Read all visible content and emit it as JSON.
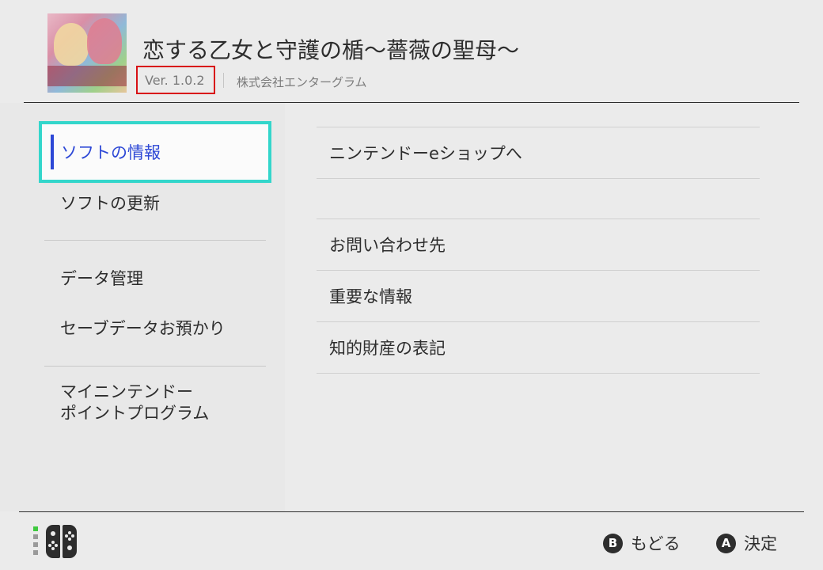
{
  "header": {
    "title": "恋する乙女と守護の楯～薔薇の聖母～",
    "version": "Ver. 1.0.2",
    "publisher": "株式会社エンターグラム",
    "icon_art_text": "恋する乙女と守護の楯"
  },
  "sidebar": {
    "items": [
      {
        "label": "ソフトの情報",
        "selected": true
      },
      {
        "label": "ソフトの更新"
      },
      {
        "label": "データ管理"
      },
      {
        "label": "セーブデータお預かり"
      },
      {
        "label_line1": "マイニンテンドー",
        "label_line2": "ポイントプログラム"
      }
    ]
  },
  "main": {
    "eshop_label": "ニンテンドーeショップへ",
    "items": [
      {
        "label": "お問い合わせ先"
      },
      {
        "label": "重要な情報"
      },
      {
        "label": "知的財産の表記"
      }
    ]
  },
  "footer": {
    "controller_status": "joy-con-attached",
    "hints": [
      {
        "button": "B",
        "label": "もどる"
      },
      {
        "button": "A",
        "label": "決定"
      }
    ]
  },
  "colors": {
    "background": "#ebebeb",
    "selection_accent": "#2d48d6",
    "selection_outline": "#33d6cb",
    "version_highlight": "#d81015",
    "controller_indicator": "#3fc93f"
  }
}
